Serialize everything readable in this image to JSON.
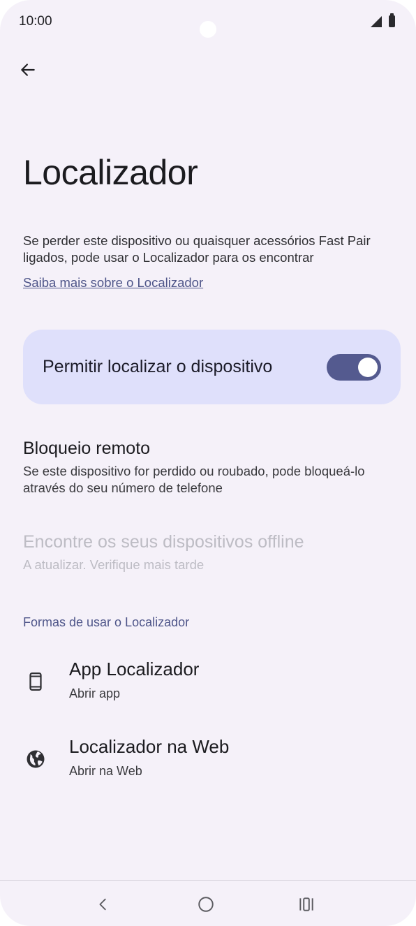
{
  "status_bar": {
    "time": "10:00"
  },
  "page": {
    "title": "Localizador",
    "description": "Se perder este dispositivo ou quaisquer acessórios Fast Pair ligados, pode usar o Localizador para os encontrar",
    "learn_more_link": "Saiba mais sobre o Localizador"
  },
  "main_toggle": {
    "label": "Permitir localizar o dispositivo",
    "on": true
  },
  "settings": [
    {
      "title": "Bloqueio remoto",
      "subtitle": "Se este dispositivo for perdido ou roubado, pode bloqueá-lo através do seu número de telefone",
      "enabled": true
    },
    {
      "title": "Encontre os seus dispositivos offline",
      "subtitle": "A atualizar. Verifique mais tarde",
      "enabled": false
    }
  ],
  "ways_section": {
    "header": "Formas de usar o Localizador",
    "items": [
      {
        "title": "App Localizador",
        "subtitle": "Abrir app",
        "icon": "phone-icon"
      },
      {
        "title": "Localizador na Web",
        "subtitle": "Abrir na Web",
        "icon": "globe-icon"
      }
    ]
  },
  "colors": {
    "background": "#f5f1f9",
    "card": "#dfe0fb",
    "accent": "#545a8f",
    "link": "#4e5589",
    "disabled_text": "#bdbcc4"
  },
  "nav_bar": {
    "buttons": [
      "back",
      "home",
      "recents"
    ]
  }
}
